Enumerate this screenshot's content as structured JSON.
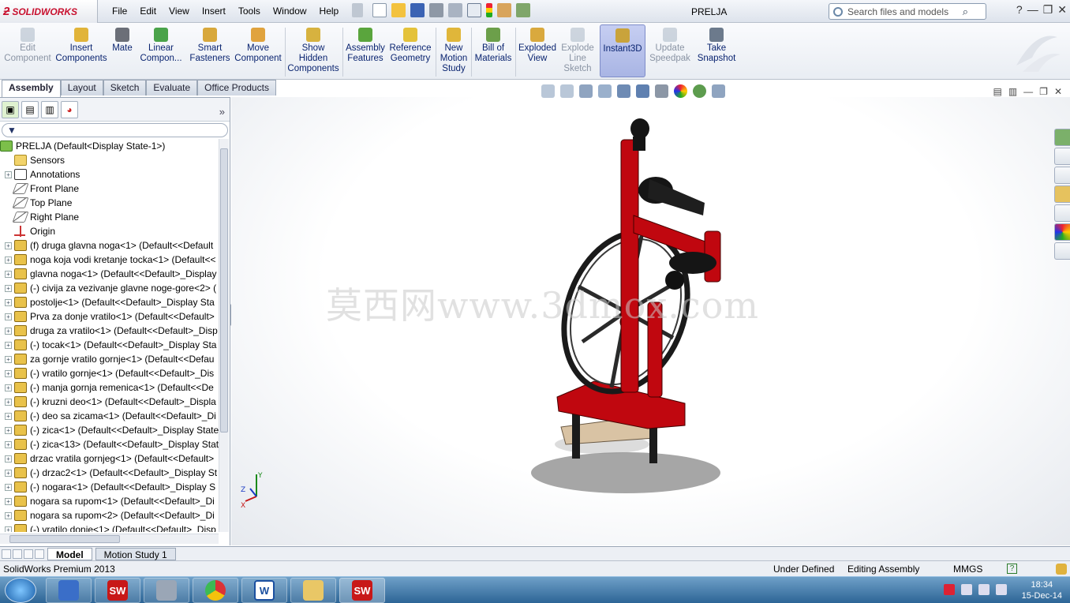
{
  "app": {
    "name": "SOLIDWORKS",
    "document_title": "PRELJA"
  },
  "menus": [
    "File",
    "Edit",
    "View",
    "Insert",
    "Tools",
    "Window",
    "Help"
  ],
  "search": {
    "placeholder": "Search files and models"
  },
  "command_manager": [
    {
      "label": "Edit Component",
      "icon": "edit-component-icon",
      "enabled": false
    },
    {
      "label": "Insert Components",
      "icon": "insert-components-icon",
      "enabled": true
    },
    {
      "label": "Mate",
      "icon": "mate-icon",
      "enabled": true
    },
    {
      "label": "Linear Compon...",
      "icon": "linear-pattern-icon",
      "enabled": true
    },
    {
      "label": "Smart Fasteners",
      "icon": "smart-fasteners-icon",
      "enabled": true
    },
    {
      "label": "Move Component",
      "icon": "move-component-icon",
      "enabled": true
    },
    {
      "label": "Show Hidden Components",
      "icon": "show-hidden-icon",
      "enabled": true
    },
    {
      "label": "Assembly Features",
      "icon": "assembly-features-icon",
      "enabled": true
    },
    {
      "label": "Reference Geometry",
      "icon": "reference-geometry-icon",
      "enabled": true
    },
    {
      "label": "New Motion Study",
      "icon": "motion-study-icon",
      "enabled": true
    },
    {
      "label": "Bill of Materials",
      "icon": "bill-of-materials-icon",
      "enabled": true
    },
    {
      "label": "Exploded View",
      "icon": "exploded-view-icon",
      "enabled": true
    },
    {
      "label": "Explode Line Sketch",
      "icon": "explode-line-icon",
      "enabled": false
    },
    {
      "label": "Instant3D",
      "icon": "instant3d-icon",
      "enabled": true,
      "active": true
    },
    {
      "label": "Update Speedpak",
      "icon": "speedpak-icon",
      "enabled": false
    },
    {
      "label": "Take Snapshot",
      "icon": "snapshot-icon",
      "enabled": true
    }
  ],
  "tabs": [
    "Assembly",
    "Layout",
    "Sketch",
    "Evaluate",
    "Office Products"
  ],
  "active_tab": "Assembly",
  "tree": {
    "root": "PRELJA  (Default<Display State-1>)",
    "items": [
      {
        "label": "Sensors",
        "icon": "sensors-icon",
        "expandable": false
      },
      {
        "label": "Annotations",
        "icon": "annotations-icon",
        "expandable": true
      },
      {
        "label": "Front Plane",
        "icon": "plane-icon",
        "expandable": false
      },
      {
        "label": "Top Plane",
        "icon": "plane-icon",
        "expandable": false
      },
      {
        "label": "Right Plane",
        "icon": "plane-icon",
        "expandable": false
      },
      {
        "label": "Origin",
        "icon": "origin-icon",
        "expandable": false
      },
      {
        "label": "(f) druga glavna noga<1> (Default<<Default",
        "icon": "part-icon",
        "expandable": true
      },
      {
        "label": "noga koja vodi kretanje tocka<1> (Default<<",
        "icon": "part-icon",
        "expandable": true
      },
      {
        "label": "glavna noga<1> (Default<<Default>_Display",
        "icon": "part-icon",
        "expandable": true
      },
      {
        "label": "(-) civija za vezivanje glavne noge-gore<2> (",
        "icon": "part-icon",
        "expandable": true
      },
      {
        "label": "postolje<1> (Default<<Default>_Display Sta",
        "icon": "part-icon",
        "expandable": true
      },
      {
        "label": "Prva za donje vratilo<1> (Default<<Default>",
        "icon": "part-icon",
        "expandable": true
      },
      {
        "label": "druga za vratilo<1> (Default<<Default>_Disp",
        "icon": "part-icon",
        "expandable": true
      },
      {
        "label": "(-) tocak<1> (Default<<Default>_Display Sta",
        "icon": "part-icon",
        "expandable": true
      },
      {
        "label": "za gornje vratilo gornje<1> (Default<<Defau",
        "icon": "part-icon",
        "expandable": true
      },
      {
        "label": "(-) vratilo gornje<1> (Default<<Default>_Dis",
        "icon": "part-icon",
        "expandable": true
      },
      {
        "label": "(-) manja gornja remenica<1> (Default<<De",
        "icon": "part-icon",
        "expandable": true
      },
      {
        "label": "(-) kruzni deo<1> (Default<<Default>_Displa",
        "icon": "part-icon",
        "expandable": true
      },
      {
        "label": "(-) deo sa zicama<1> (Default<<Default>_Di",
        "icon": "part-icon",
        "expandable": true
      },
      {
        "label": "(-) zica<1> (Default<<Default>_Display State",
        "icon": "part-icon",
        "expandable": true
      },
      {
        "label": "(-) zica<13> (Default<<Default>_Display Stat",
        "icon": "part-icon",
        "expandable": true
      },
      {
        "label": "drzac vratila gornjeg<1> (Default<<Default>",
        "icon": "part-icon",
        "expandable": true
      },
      {
        "label": "(-) drzac2<1> (Default<<Default>_Display St",
        "icon": "part-icon",
        "expandable": true
      },
      {
        "label": "(-) nogara<1> (Default<<Default>_Display S",
        "icon": "part-icon",
        "expandable": true
      },
      {
        "label": "nogara sa rupom<1> (Default<<Default>_Di",
        "icon": "part-icon",
        "expandable": true
      },
      {
        "label": "nogara sa rupom<2> (Default<<Default>_Di",
        "icon": "part-icon",
        "expandable": true
      },
      {
        "label": "(-) vratilo donje<1> (Default<<Default>_Disp",
        "icon": "part-icon",
        "expandable": true
      }
    ]
  },
  "watermark": "莫西网www.3dmox.com",
  "bottom_tabs": [
    "Model",
    "Motion Study 1"
  ],
  "status": {
    "product": "SolidWorks Premium 2013",
    "state": "Under Defined",
    "mode": "Editing Assembly",
    "units": "MMGS"
  },
  "taskbar": {
    "time": "18:34",
    "date": "15-Dec-14"
  },
  "colors": {
    "frame_red": "#c0070f",
    "accent_blue": "#0a2470",
    "taskbar": "#2d6596"
  }
}
